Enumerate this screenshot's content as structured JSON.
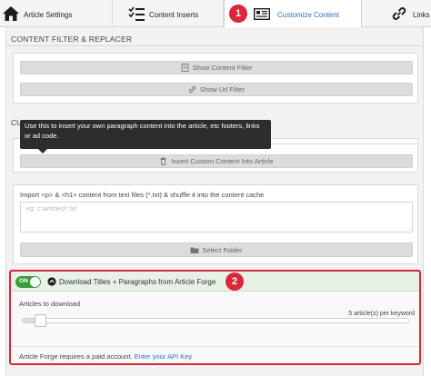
{
  "tabs": [
    {
      "label": "Article Settings",
      "icon": "home-icon"
    },
    {
      "label": "Content Inserts",
      "icon": "list-checks-icon"
    },
    {
      "label": "Customize Content",
      "icon": "customize-content-icon",
      "active": true
    },
    {
      "label": "Links",
      "icon": "link-icon"
    }
  ],
  "markers": {
    "one": "1",
    "two": "2"
  },
  "filter_section": {
    "title": "CONTENT FILTER & REPLACER",
    "show_content_filter": "Show Content Filter",
    "show_url_filter": "Show Url Filter"
  },
  "custom_section": {
    "partial_heading": "CU",
    "tooltip": "Use this to insert your own paragraph content into the article, etc footers, links or ad code.",
    "insert_button": "Insert Custom Content Into Article"
  },
  "import": {
    "label": "Import <p> & <h1> content from text files (*.txt) & shuffle it into the content cache",
    "placeholder": "eg: c:\\articles\\*.txt",
    "select_folder": "Select Folder"
  },
  "article_forge": {
    "toggle_label": "ON",
    "title": "Download Titles + Paragraphs from Article Forge",
    "articles_label": "Articles to download",
    "slider_value": 5,
    "per_keyword": "5 article(s) per keyword",
    "paid_note": "Article Forge requires a paid account.",
    "api_link": "Enter your API Key"
  },
  "colors": {
    "accent": "#2e6fbf",
    "marker": "#d9263a",
    "toggle_on": "#3a9b3a"
  }
}
